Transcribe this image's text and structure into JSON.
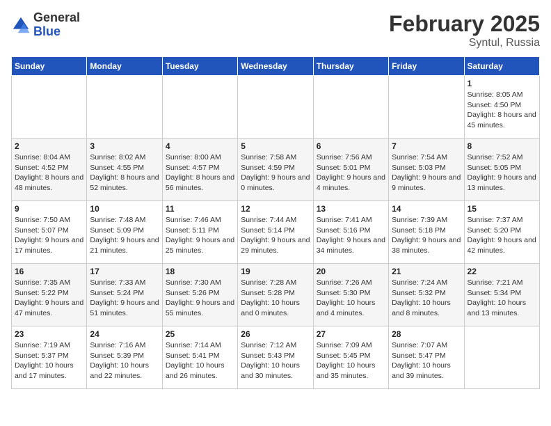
{
  "logo": {
    "general": "General",
    "blue": "Blue"
  },
  "title": "February 2025",
  "location": "Syntul, Russia",
  "days_of_week": [
    "Sunday",
    "Monday",
    "Tuesday",
    "Wednesday",
    "Thursday",
    "Friday",
    "Saturday"
  ],
  "weeks": [
    [
      {
        "day": "",
        "info": ""
      },
      {
        "day": "",
        "info": ""
      },
      {
        "day": "",
        "info": ""
      },
      {
        "day": "",
        "info": ""
      },
      {
        "day": "",
        "info": ""
      },
      {
        "day": "",
        "info": ""
      },
      {
        "day": "1",
        "info": "Sunrise: 8:05 AM\nSunset: 4:50 PM\nDaylight: 8 hours and 45 minutes."
      }
    ],
    [
      {
        "day": "2",
        "info": "Sunrise: 8:04 AM\nSunset: 4:52 PM\nDaylight: 8 hours and 48 minutes."
      },
      {
        "day": "3",
        "info": "Sunrise: 8:02 AM\nSunset: 4:55 PM\nDaylight: 8 hours and 52 minutes."
      },
      {
        "day": "4",
        "info": "Sunrise: 8:00 AM\nSunset: 4:57 PM\nDaylight: 8 hours and 56 minutes."
      },
      {
        "day": "5",
        "info": "Sunrise: 7:58 AM\nSunset: 4:59 PM\nDaylight: 9 hours and 0 minutes."
      },
      {
        "day": "6",
        "info": "Sunrise: 7:56 AM\nSunset: 5:01 PM\nDaylight: 9 hours and 4 minutes."
      },
      {
        "day": "7",
        "info": "Sunrise: 7:54 AM\nSunset: 5:03 PM\nDaylight: 9 hours and 9 minutes."
      },
      {
        "day": "8",
        "info": "Sunrise: 7:52 AM\nSunset: 5:05 PM\nDaylight: 9 hours and 13 minutes."
      }
    ],
    [
      {
        "day": "9",
        "info": "Sunrise: 7:50 AM\nSunset: 5:07 PM\nDaylight: 9 hours and 17 minutes."
      },
      {
        "day": "10",
        "info": "Sunrise: 7:48 AM\nSunset: 5:09 PM\nDaylight: 9 hours and 21 minutes."
      },
      {
        "day": "11",
        "info": "Sunrise: 7:46 AM\nSunset: 5:11 PM\nDaylight: 9 hours and 25 minutes."
      },
      {
        "day": "12",
        "info": "Sunrise: 7:44 AM\nSunset: 5:14 PM\nDaylight: 9 hours and 29 minutes."
      },
      {
        "day": "13",
        "info": "Sunrise: 7:41 AM\nSunset: 5:16 PM\nDaylight: 9 hours and 34 minutes."
      },
      {
        "day": "14",
        "info": "Sunrise: 7:39 AM\nSunset: 5:18 PM\nDaylight: 9 hours and 38 minutes."
      },
      {
        "day": "15",
        "info": "Sunrise: 7:37 AM\nSunset: 5:20 PM\nDaylight: 9 hours and 42 minutes."
      }
    ],
    [
      {
        "day": "16",
        "info": "Sunrise: 7:35 AM\nSunset: 5:22 PM\nDaylight: 9 hours and 47 minutes."
      },
      {
        "day": "17",
        "info": "Sunrise: 7:33 AM\nSunset: 5:24 PM\nDaylight: 9 hours and 51 minutes."
      },
      {
        "day": "18",
        "info": "Sunrise: 7:30 AM\nSunset: 5:26 PM\nDaylight: 9 hours and 55 minutes."
      },
      {
        "day": "19",
        "info": "Sunrise: 7:28 AM\nSunset: 5:28 PM\nDaylight: 10 hours and 0 minutes."
      },
      {
        "day": "20",
        "info": "Sunrise: 7:26 AM\nSunset: 5:30 PM\nDaylight: 10 hours and 4 minutes."
      },
      {
        "day": "21",
        "info": "Sunrise: 7:24 AM\nSunset: 5:32 PM\nDaylight: 10 hours and 8 minutes."
      },
      {
        "day": "22",
        "info": "Sunrise: 7:21 AM\nSunset: 5:34 PM\nDaylight: 10 hours and 13 minutes."
      }
    ],
    [
      {
        "day": "23",
        "info": "Sunrise: 7:19 AM\nSunset: 5:37 PM\nDaylight: 10 hours and 17 minutes."
      },
      {
        "day": "24",
        "info": "Sunrise: 7:16 AM\nSunset: 5:39 PM\nDaylight: 10 hours and 22 minutes."
      },
      {
        "day": "25",
        "info": "Sunrise: 7:14 AM\nSunset: 5:41 PM\nDaylight: 10 hours and 26 minutes."
      },
      {
        "day": "26",
        "info": "Sunrise: 7:12 AM\nSunset: 5:43 PM\nDaylight: 10 hours and 30 minutes."
      },
      {
        "day": "27",
        "info": "Sunrise: 7:09 AM\nSunset: 5:45 PM\nDaylight: 10 hours and 35 minutes."
      },
      {
        "day": "28",
        "info": "Sunrise: 7:07 AM\nSunset: 5:47 PM\nDaylight: 10 hours and 39 minutes."
      },
      {
        "day": "",
        "info": ""
      }
    ]
  ]
}
